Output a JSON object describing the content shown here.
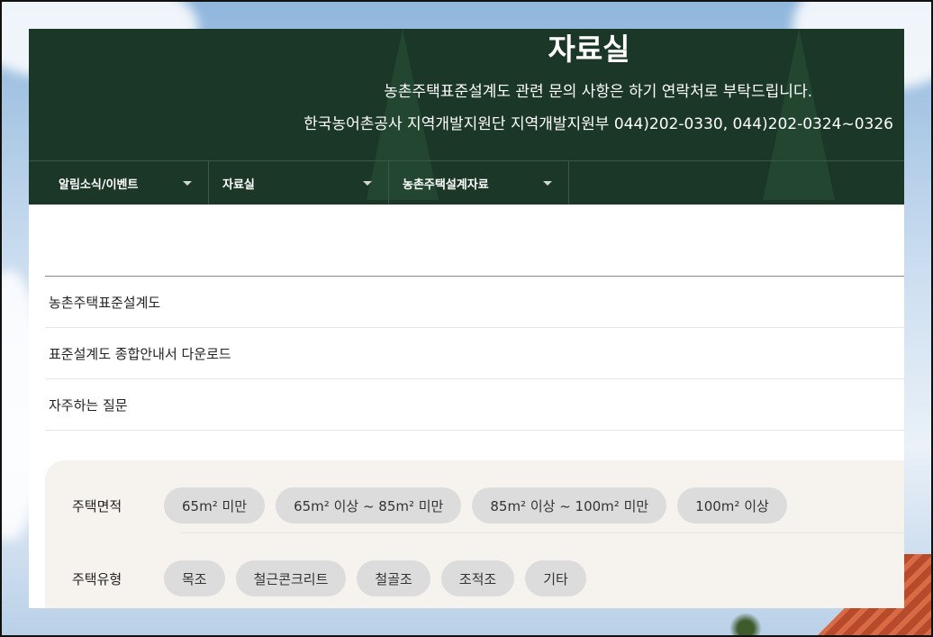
{
  "hero": {
    "title": "자료실",
    "line1": "농촌주택표준설계도 관련 문의 사항은 하기 연락처로 부탁드립니다.",
    "line2": "한국농어촌공사 지역개발지원단 지역개발지원부 044)202-0330, 044)202-0324~0326"
  },
  "nav": {
    "items": [
      {
        "label": "알림소식/이벤트",
        "icon": "chevron-down-icon"
      },
      {
        "label": "자료실",
        "icon": "chevron-down-icon"
      },
      {
        "label": "농촌주택설계자료",
        "icon": "chevron-down-icon"
      }
    ]
  },
  "submenu": {
    "items": [
      {
        "label": "농촌주택표준설계도"
      },
      {
        "label": "표준설계도 종합안내서 다운로드"
      },
      {
        "label": "자주하는 질문"
      }
    ]
  },
  "filter": {
    "area": {
      "label": "주택면적",
      "options": [
        "65m² 미만",
        "65m² 이상 ~ 85m² 미만",
        "85m² 이상 ~ 100m² 미만",
        "100m² 이상"
      ]
    },
    "type": {
      "label": "주택유형",
      "options": [
        "목조",
        "철근콘크리트",
        "철골조",
        "조적조",
        "기타"
      ]
    }
  },
  "colors": {
    "hero_bg": "#1b3727",
    "chip_bg": "#dcdcdc",
    "filter_bg": "#f6f3ee"
  }
}
